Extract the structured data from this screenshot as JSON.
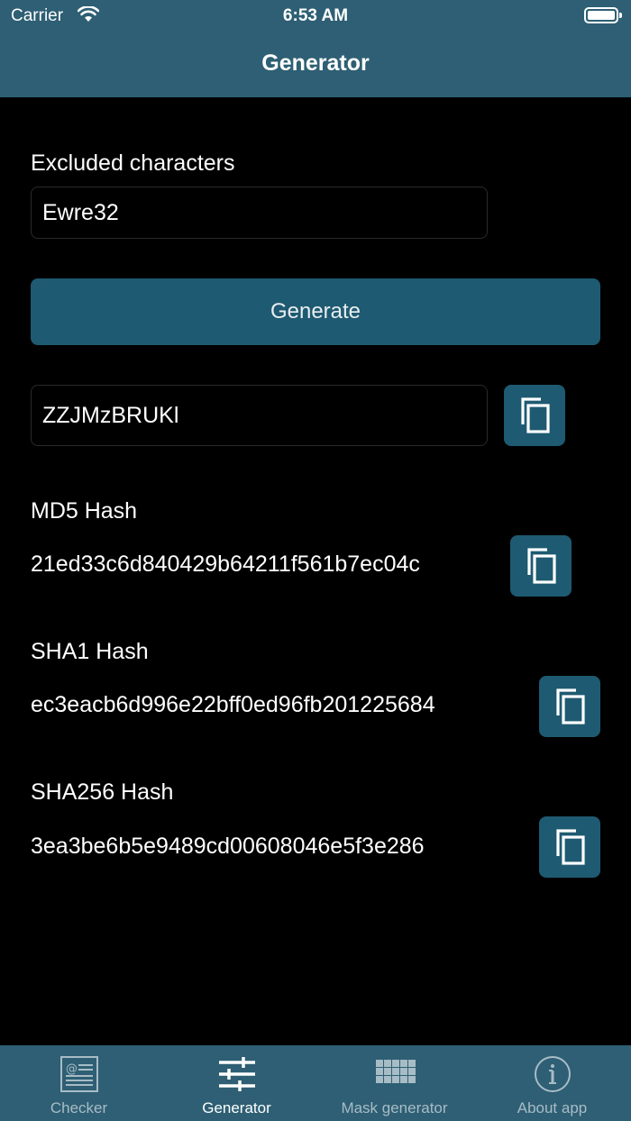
{
  "status_bar": {
    "carrier": "Carrier",
    "time": "6:53 AM"
  },
  "header": {
    "title": "Generator"
  },
  "excluded": {
    "label": "Excluded characters",
    "value": "Ewre32"
  },
  "generate": {
    "label": "Generate"
  },
  "result": {
    "value": "ZZJMzBRUKl"
  },
  "md5": {
    "label": "MD5 Hash",
    "value": "21ed33c6d840429b64211f561b7ec04c"
  },
  "sha1": {
    "label": "SHA1 Hash",
    "value": "ec3eacb6d996e22bff0ed96fb201225684"
  },
  "sha256": {
    "label": "SHA256 Hash",
    "value": "3ea3be6b5e9489cd00608046e5f3e286"
  },
  "tabs": [
    {
      "label": "Checker",
      "icon": "checker-icon",
      "active": false
    },
    {
      "label": "Generator",
      "icon": "sliders-icon",
      "active": true
    },
    {
      "label": "Mask generator",
      "icon": "grid-icon",
      "active": false
    },
    {
      "label": "About app",
      "icon": "info-icon",
      "active": false
    }
  ],
  "colors": {
    "bar": "#2e5f74",
    "button": "#1e5a71",
    "background": "#000000"
  }
}
